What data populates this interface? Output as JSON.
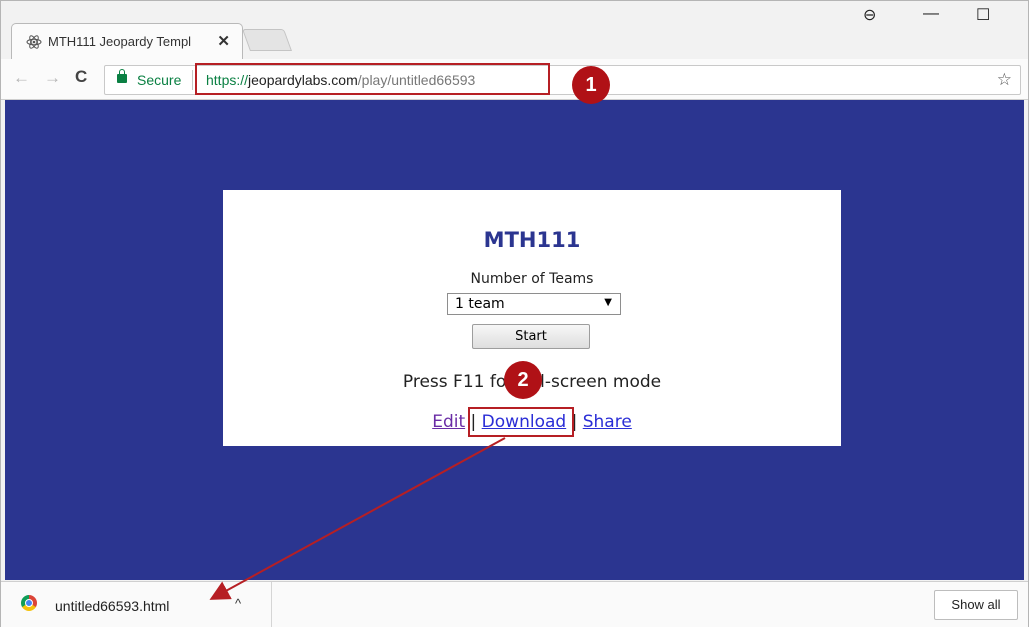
{
  "browser": {
    "tab_title": "MTH111 Jeopardy Templ",
    "tab_close": "✕",
    "window_controls": {
      "profile": "⊖",
      "minimize": "—",
      "maximize": "☐"
    },
    "nav": {
      "back": "←",
      "forward": "→",
      "reload": "C"
    },
    "secure_label": "Secure",
    "url": {
      "scheme": "https://",
      "host": "jeopardylabs.com",
      "path": "/play/untitled66593"
    },
    "bookmark": "☆"
  },
  "page": {
    "title": "MTH111",
    "teams_label": "Number of Teams",
    "teams_select_value": "1 team",
    "select_arrow": "▼",
    "start_button": "Start",
    "hint_text": "Press F11 for full-screen mode",
    "links": {
      "edit": "Edit",
      "sep1": " | ",
      "download": "Download",
      "sep2": " | ",
      "share": "Share"
    },
    "colors": {
      "background": "#2b3590",
      "title": "#2b3590",
      "link": "#2a2dd6"
    }
  },
  "annotations": {
    "badge1": "1",
    "badge2": "2",
    "highlight_color": "#b61f24"
  },
  "download_bar": {
    "filename": "untitled66593.html",
    "caret": "^",
    "show_all": "Show all"
  }
}
